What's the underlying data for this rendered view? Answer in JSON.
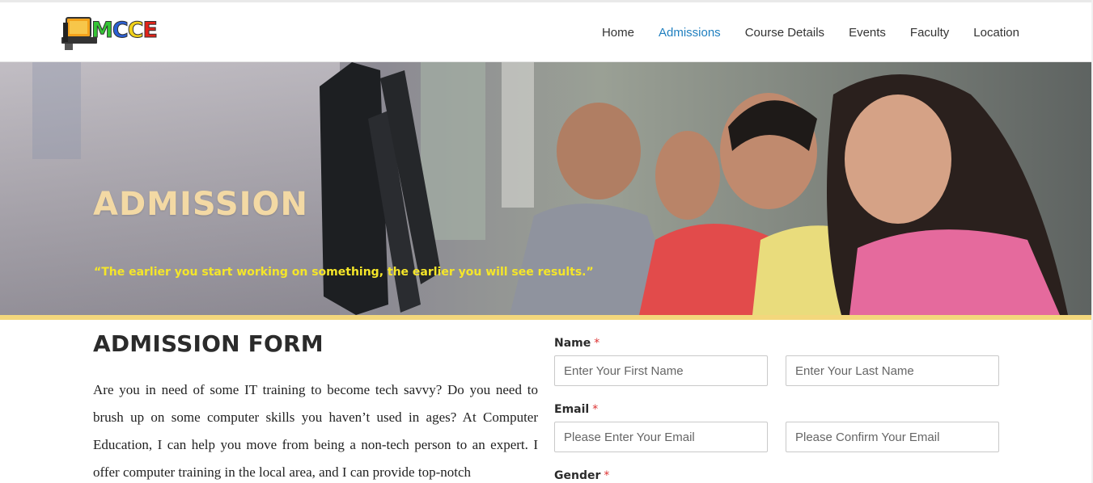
{
  "brand": {
    "logo_text": "MCCE"
  },
  "nav": {
    "items": [
      {
        "label": "Home",
        "active": false
      },
      {
        "label": "Admissions",
        "active": true
      },
      {
        "label": "Course Details",
        "active": false
      },
      {
        "label": "Events",
        "active": false
      },
      {
        "label": "Faculty",
        "active": false
      },
      {
        "label": "Location",
        "active": false
      }
    ]
  },
  "hero": {
    "title": "ADMISSION",
    "quote": "“The earlier you start working on something, the earlier you will see results.”"
  },
  "content": {
    "heading": "ADMISSION FORM",
    "intro": "Are you in need of some IT training to become tech savvy? Do you need to brush up on some computer skills you haven’t used in ages? At Computer Education, I can help you move from being a non-tech person to an expert. I offer computer training in the local area, and I can provide top-notch"
  },
  "form": {
    "name_label": "Name",
    "first_name_placeholder": "Enter Your First Name",
    "last_name_placeholder": "Enter Your Last Name",
    "email_label": "Email",
    "email_placeholder": "Please Enter Your Email",
    "confirm_email_placeholder": "Please Confirm Your Email",
    "gender_label": "Gender",
    "required_mark": "*"
  },
  "colors": {
    "nav_active": "#1f7fbf",
    "hero_title": "#f3d9a4",
    "hero_quote": "#f5e629",
    "hero_bar": "#f3d77c",
    "required": "#dd3333"
  }
}
